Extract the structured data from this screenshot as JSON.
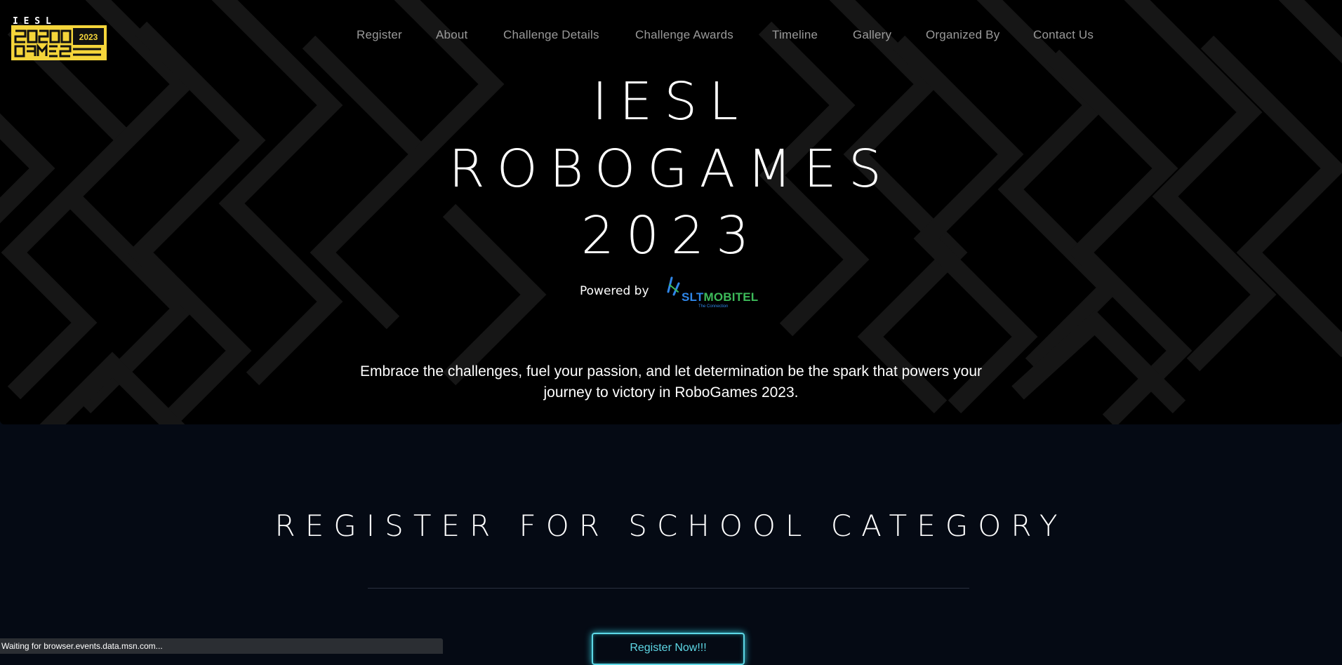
{
  "logo": {
    "top_text": "I  E  S  L",
    "year": "2023",
    "word": "ROBOGAMES"
  },
  "nav": {
    "items": [
      "Register",
      "About",
      "Challenge Details",
      "Challenge Awards",
      "Timeline",
      "Gallery",
      "Organized By",
      "Contact Us"
    ]
  },
  "hero": {
    "title_line1": "IESL",
    "title_line2": "ROBOGAMES",
    "title_line3": "2023",
    "powered_by": "Powered by",
    "sponsor_part1": "SLT",
    "sponsor_part2": "MOBITEL",
    "sponsor_tagline": "The Connection",
    "tagline": "Embrace the challenges, fuel your passion, and let determination be the spark that powers your journey to victory in RoboGames 2023."
  },
  "register": {
    "title": "REGISTER FOR SCHOOL CATEGORY",
    "button_label": "Register Now!!!"
  },
  "status_bar": {
    "text": "Waiting for browser.events.data.msn.com..."
  },
  "colors": {
    "hero_bg": "#000000",
    "pattern": "#161616",
    "page_bg": "#050a14",
    "logo_yellow": "#f5d53a",
    "button_cyan": "#5ed8e6",
    "sponsor_blue": "#2f86e8",
    "sponsor_green": "#3dbb5a"
  }
}
